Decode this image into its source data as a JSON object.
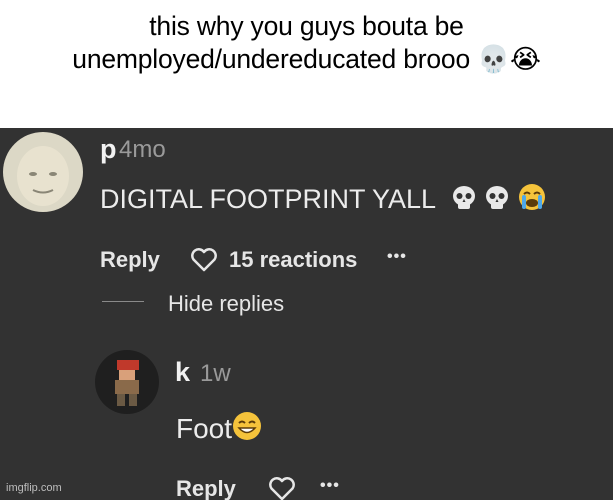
{
  "caption": "this why you guys bouta be unemployed/undereducated brooo 💀😭",
  "comment": {
    "username": "p",
    "age": "4mo",
    "text": "DIGITAL FOOTPRINT YALL",
    "emojis": [
      "skull-emoji",
      "skull-emoji",
      "crying-emoji"
    ],
    "reply_label": "Reply",
    "reactions_label": "15 reactions",
    "more_label": "•••",
    "hide_replies_label": "Hide replies"
  },
  "reply": {
    "username": "k",
    "age": "1w",
    "text": "Foot",
    "emoji": "grinning-sweat-emoji",
    "reply_label": "Reply",
    "more_label": "•••"
  },
  "watermark": "imgflip.com",
  "colors": {
    "background": "#323232",
    "text": "#ececec",
    "muted": "#9a9a9a"
  }
}
